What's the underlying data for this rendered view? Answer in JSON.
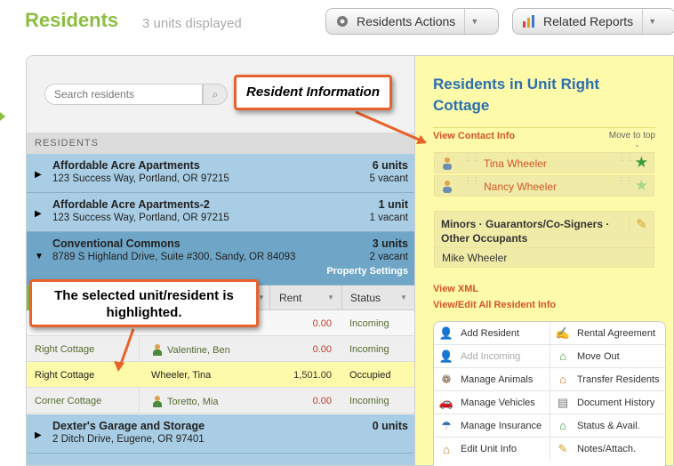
{
  "header": {
    "title": "Residents",
    "units_displayed": "3 units displayed",
    "actions_button": "Residents Actions",
    "reports_button": "Related Reports"
  },
  "search": {
    "placeholder": "Search residents"
  },
  "residents_header": "RESIDENTS",
  "properties": [
    {
      "name": "Affordable Acre Apartments",
      "address": "123 Success Way, Portland, OR 97215",
      "units": "6 units",
      "vacant": "5 vacant"
    },
    {
      "name": "Affordable Acre Apartments-2",
      "address": "123 Success Way, Portland, OR 97215",
      "units": "1 unit",
      "vacant": "1 vacant"
    },
    {
      "name": "Conventional Commons",
      "address": "8789 S Highland Drive, Suite #300, Sandy, OR 84093",
      "units": "3 units",
      "vacant": "2 vacant",
      "settings": "Property Settings"
    },
    {
      "name": "Dexter's Garage and Storage",
      "address": "2 Ditch Drive, Eugene, OR 97401",
      "units": "0 units"
    }
  ],
  "table": {
    "columns": {
      "rent": "Rent",
      "status": "Status"
    },
    "rows": [
      {
        "unit": "",
        "resident": "",
        "rent": "0.00",
        "status": "Incoming"
      },
      {
        "unit": "Right Cottage",
        "resident": "Valentine, Ben",
        "rent": "0.00",
        "status": "Incoming"
      },
      {
        "unit": "Right Cottage",
        "resident": "Wheeler, Tina",
        "rent": "1,501.00",
        "status": "Occupied"
      },
      {
        "unit": "Corner Cottage",
        "resident": "Toretto, Mia",
        "rent": "0.00",
        "status": "Incoming"
      }
    ]
  },
  "callouts": {
    "resident_info": "Resident Information",
    "selected": "The selected unit/resident is highlighted."
  },
  "panel": {
    "title": "Residents in Unit Right Cottage",
    "view_contact": "View Contact Info",
    "move_to_top": "Move to top",
    "residents": [
      "Tina Wheeler",
      "Nancy Wheeler"
    ],
    "minors_title": "Minors · Guarantors/Co-Signers · Other Occupants",
    "minors_name": "Mike Wheeler",
    "view_xml": "View XML",
    "view_edit_all": "View/Edit All Resident Info"
  },
  "actions": {
    "left": [
      "Add Resident",
      "Add Incoming",
      "Manage Animals",
      "Manage Vehicles",
      "Manage Insurance",
      "Edit Unit Info"
    ],
    "right": [
      "Rental Agreement",
      "Move Out",
      "Transfer Residents",
      "Document History",
      "Status & Avail.",
      "Notes/Attach."
    ]
  },
  "colors": {
    "accent_green": "#8bbf3f",
    "link_orange": "#d4542a",
    "title_blue": "#2a6fb0",
    "property_blue": "#a8cde4",
    "selected_yellow": "#fdfaa9",
    "callout_border": "#e8622c"
  }
}
